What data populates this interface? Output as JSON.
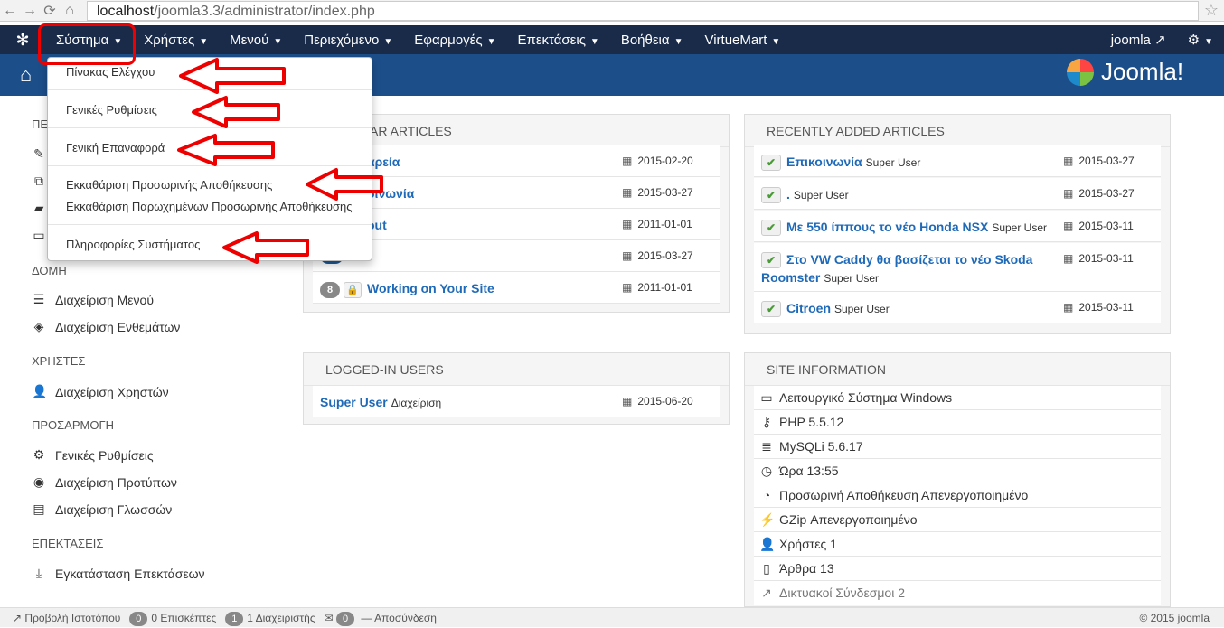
{
  "browser": {
    "url_host": "localhost",
    "url_path": "/joomla3.3/administrator/index.php"
  },
  "topnav": {
    "menu": [
      "Σύστημα",
      "Χρήστες",
      "Μενού",
      "Περιεχόμενο",
      "Εφαρμογές",
      "Επεκτάσεις",
      "Βοήθεια",
      "VirtueMart"
    ],
    "user": "joomla"
  },
  "brand": "Joomla!",
  "dropdown": [
    "Πίνακας Ελέγχου",
    "Γενικές Ρυθμίσεις",
    "Γενική Επαναφορά",
    "Εκκαθάριση Προσωρινής Αποθήκευσης",
    "Εκκαθάριση Παρωχημένων Προσωρινής Αποθήκευσης",
    "Πληροφορίες Συστήματος"
  ],
  "sidebar": {
    "partial_group": "ΠΕ",
    "groups": [
      "ΔΟΜΗ",
      "ΧΡΗΣΤΕΣ",
      "ΠΡΟΣΑΡΜΟΓΗ",
      "ΕΠΕΚΤΑΣΕΙΣ"
    ],
    "links": [
      "Διαχείριση Μενού",
      "Διαχείριση Ενθεμάτων",
      "Διαχείριση Χρηστών",
      "Γενικές Ρυθμίσεις",
      "Διαχείριση Προτύπων",
      "Διαχείριση Γλωσσών",
      "Εγκατάσταση Επεκτάσεων"
    ]
  },
  "popular": {
    "title_visible": "AR ARTICLES",
    "rows": [
      {
        "title": "αρεία",
        "date": "2015-02-20"
      },
      {
        "title": "οινωνία",
        "date": "2015-03-27"
      },
      {
        "title": "out",
        "date": "2011-01-01"
      },
      {
        "title": "",
        "date": "2015-03-27"
      },
      {
        "hits": "8",
        "title": "Working on Your Site",
        "date": "2011-01-01"
      }
    ]
  },
  "recent": {
    "title": "RECENTLY ADDED ARTICLES",
    "rows": [
      {
        "title": "Επικοινωνία",
        "by": "Super User",
        "date": "2015-03-27"
      },
      {
        "title": ".",
        "by": "Super User",
        "date": "2015-03-27"
      },
      {
        "title": "Με 550 ίππους το νέο Honda NSX",
        "by": "Super User",
        "date": "2015-03-11"
      },
      {
        "title": "Στο VW Caddy θα βασίζεται το νέο Skoda",
        "title2": "Roomster",
        "by": "Super User",
        "date": "2015-03-11"
      },
      {
        "title": "Citroen",
        "by": "Super User",
        "date": "2015-03-11"
      }
    ]
  },
  "logged": {
    "title": "LOGGED-IN USERS",
    "rows": [
      {
        "name": "Super User",
        "role": "Διαχείριση",
        "date": "2015-06-20"
      }
    ]
  },
  "siteinfo": {
    "title": "SITE INFORMATION",
    "rows": [
      "Λειτουργικό Σύστημα Windows",
      "PHP 5.5.12",
      "MySQLi 5.6.17",
      "Ώρα 13:55",
      "Προσωρινή Αποθήκευση Απενεργοποιημένο",
      "GZip Απενεργοποιημένο",
      "Χρήστες 1",
      "Άρθρα 13",
      "Δικτυακοί Σύνδεσμοι 2"
    ]
  },
  "footer": {
    "view_site": "Προβολή Ιστοτόπου",
    "visitors_count": "0",
    "visitors": "0 Επισκέπτες",
    "admins_count": "1",
    "admins": "1 Διαχειριστής",
    "messages_count": "0",
    "logout": "Αποσύνδεση",
    "copyright": "© 2015 joomla"
  },
  "colors": {
    "nav": "#1a2b4a",
    "subbar": "#1c4f8a",
    "annotation": "#e00000",
    "link": "#1f6ab8"
  }
}
